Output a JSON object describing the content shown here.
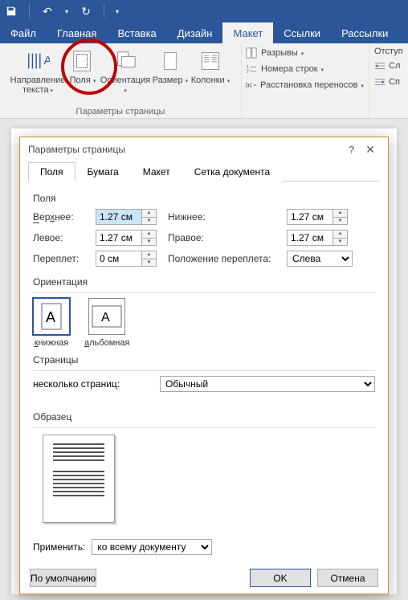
{
  "qat": {
    "undo_tip": "↶",
    "redo_tip": "↷"
  },
  "tabs": {
    "file": "Файл",
    "home": "Главная",
    "insert": "Вставка",
    "design": "Дизайн",
    "layout": "Макет",
    "refs": "Ссылки",
    "mail": "Рассылки"
  },
  "ribbon": {
    "text_direction": "Направление текста",
    "margins": "Поля",
    "orientation": "Ориентация",
    "size": "Размер",
    "columns": "Колонки",
    "breaks": "Разрывы",
    "line_numbers": "Номера строк",
    "hyphenation": "Расстановка переносов",
    "group_page_setup": "Параметры страницы",
    "indent": "Отступ",
    "indent_left": "Сл",
    "indent_right": "Сп"
  },
  "dialog": {
    "title": "Параметры страницы",
    "tabs": {
      "margins": "Поля",
      "paper": "Бумага",
      "layout": "Макет",
      "grid": "Сетка документа"
    },
    "section_margins": "Поля",
    "top": "Верхнее:",
    "bottom": "Нижнее:",
    "left": "Левое:",
    "right": "Правое:",
    "gutter": "Переплет:",
    "gutter_pos": "Положение переплета:",
    "val_top": "1.27 см",
    "val_bottom": "1.27 см",
    "val_left": "1.27 см",
    "val_right": "1.27 см",
    "val_gutter": "0 см",
    "gutter_pos_val": "Слева",
    "section_orientation": "Ориентация",
    "portrait": "книжная",
    "landscape": "альбомная",
    "section_pages": "Страницы",
    "multi_pages": "несколько страниц:",
    "multi_pages_val": "Обычный",
    "section_preview": "Образец",
    "apply": "Применить:",
    "apply_val": "ко всему документу",
    "default_btn": "По умолчанию",
    "ok": "OK",
    "cancel": "Отмена"
  }
}
